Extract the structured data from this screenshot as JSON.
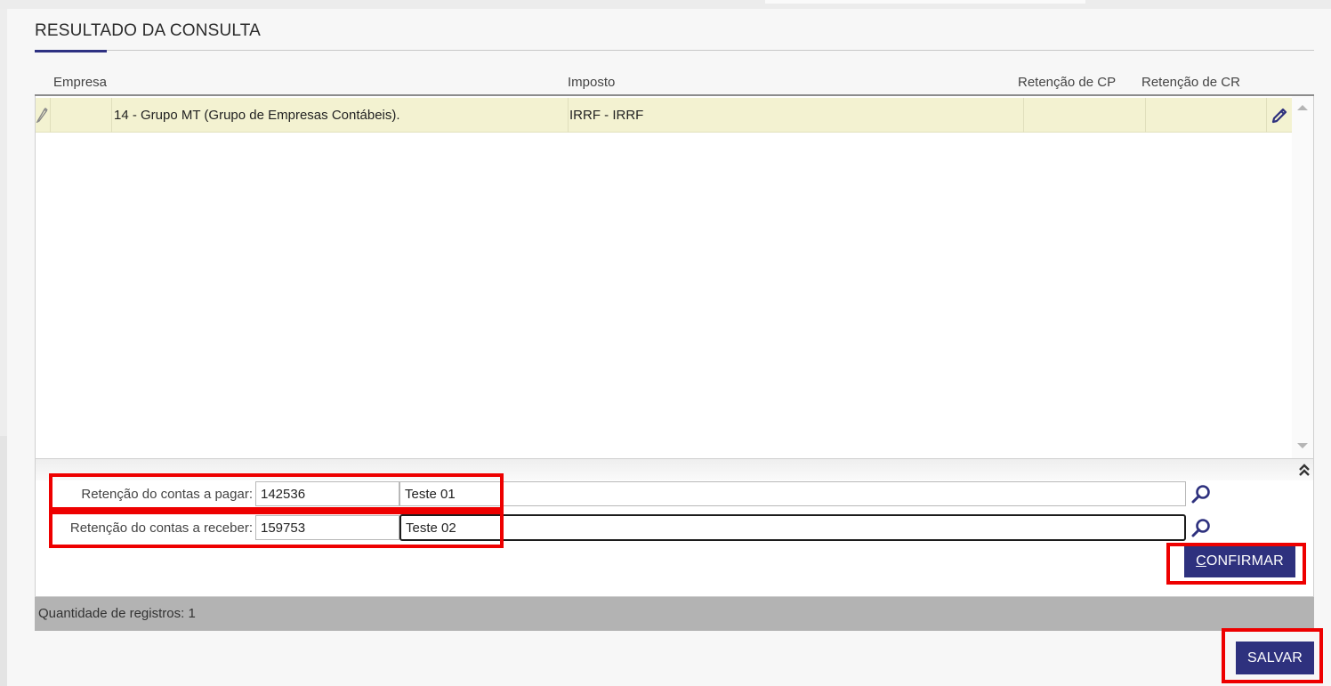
{
  "section": {
    "title": "RESULTADO DA CONSULTA"
  },
  "grid": {
    "columns": [
      "Empresa",
      "Imposto",
      "Retenção de CP",
      "Retenção de CR"
    ],
    "rows": [
      {
        "empresa": "14 - Grupo MT (Grupo de Empresas Contábeis).",
        "imposto": "IRRF - IRRF",
        "retencao_cp": "",
        "retencao_cr": ""
      }
    ]
  },
  "form": {
    "pagar": {
      "label": "Retenção do contas a pagar:",
      "code": "142536",
      "description": "Teste 01"
    },
    "receber": {
      "label": "Retenção do contas a receber:",
      "code": "159753",
      "description": "Teste 02"
    },
    "confirm_first": "C",
    "confirm_rest": "ONFIRMAR"
  },
  "footer": {
    "record_count_label": "Quantidade de registros:",
    "record_count": "1"
  },
  "actions": {
    "save_label": "SALVAR"
  },
  "colors": {
    "accent": "#2e317e",
    "highlight": "#ee0000",
    "row_selected": "#f3f2d1",
    "footer": "#b3b3b3"
  },
  "icons": {
    "row_indicator": "pencil-icon",
    "row_edit": "edit-icon",
    "lookup": "magnifier-icon",
    "collapse": "double-chevron-up-icon"
  }
}
